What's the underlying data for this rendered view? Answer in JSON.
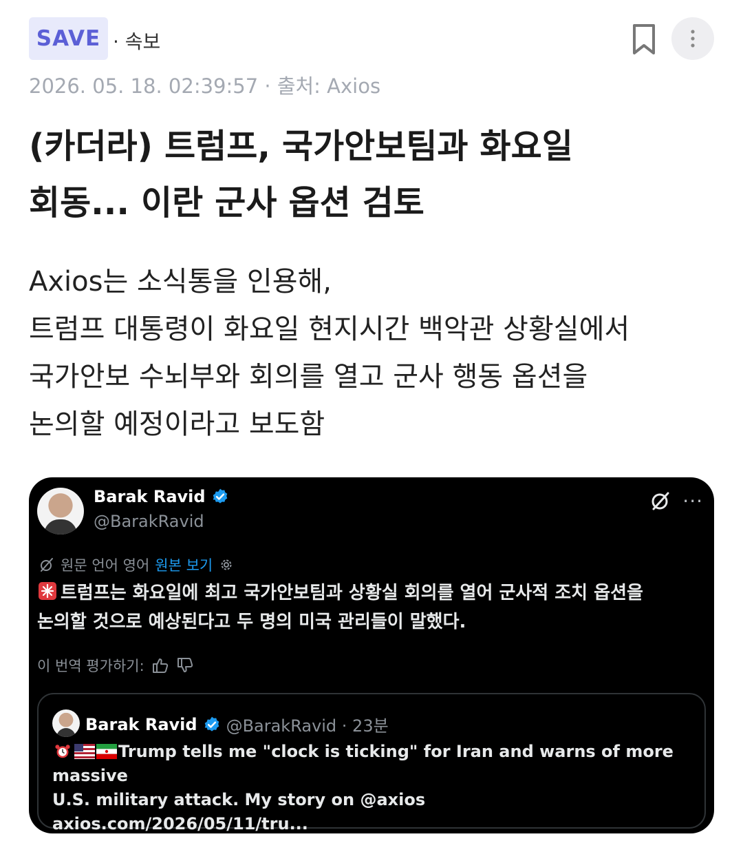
{
  "header": {
    "save_label": "SAVE",
    "category": "· 속보",
    "icons": [
      "bookmark-icon",
      "more-vertical-icon"
    ]
  },
  "meta": "2026. 05. 18. 02:39:57 · 출처: Axios",
  "title_lines": [
    "(카더라) 트럼프, 국가안보팀과 화요일",
    "회동... 이란 군사 옵션 검토"
  ],
  "body_lines": [
    "Axios는 소식통을 인용해,",
    "트럼프 대통령이 화요일 현지시간 백악관 상황실에서",
    "국가안보 수뇌부와 회의를 열고 군사 행동 옵션을",
    "논의할 예정이라고 보도함"
  ],
  "tweet": {
    "name": "Barak Ravid",
    "handle": "@BarakRavid",
    "translate_label": "원문 언어 영어",
    "translate_link": "원본 보기",
    "text_line1": "트럼프는 화요일에 최고 국가안보팀과 상황실 회의를 열어 군사적 조치 옵션을",
    "text_line2": "논의할 것으로 예상된다고 두 명의 미국 관리들이 말했다.",
    "rate_label": "이 번역 평가하기:",
    "more": "···",
    "quote": {
      "name": "Barak Ravid",
      "handle": "@BarakRavid · 23분",
      "line1": "Trump tells me \"clock is ticking\" for Iran and warns of more massive",
      "line2": "U.S. military attack. My story on @axios",
      "line3": "axios.com/2026/05/11/tru..."
    }
  },
  "colors": {
    "accent": "#5b5fd6",
    "save_bg": "#e8eafb",
    "meta": "#a4a9b2",
    "tweet_bg": "#000000",
    "link": "#1d9bf0",
    "verified": "#1d9bf0"
  }
}
